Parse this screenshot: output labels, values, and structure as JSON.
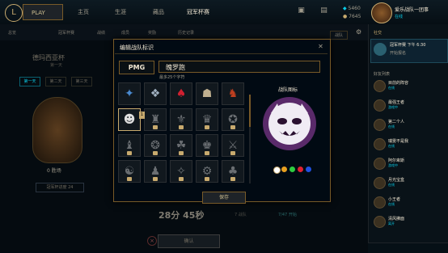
{
  "topbar": {
    "logo": "L",
    "play": "PLAY",
    "tabs": [
      "主页",
      "生涯",
      "藏品",
      "冠军杯赛"
    ],
    "currency_be": "5460",
    "currency_rp": "7645",
    "username": "爱乐战队一团事",
    "status": "在线"
  },
  "subnav": {
    "tabs": [
      "总览",
      "冠军杯赛",
      "战绩",
      "成员",
      "奖励",
      "历史记录"
    ],
    "right_button": "战队"
  },
  "background": {
    "cup_title": "德玛西亚杯",
    "cup_sub": "第一天",
    "days": [
      "第一天",
      "第二天",
      "第三天"
    ],
    "wins": "0 胜场",
    "progress_chip": "冠军杯进度 24",
    "timer": "28分 45秒",
    "confirm": "确认",
    "info_left": "7 战队",
    "info_right": "7/47 开始"
  },
  "social": {
    "header": "社交",
    "notif_title": "冠军杯赛 下午 6:30",
    "notif_body": "开始报名",
    "friends_header": "好友列表",
    "friends": [
      {
        "name": "目前的阵容",
        "status": "在线"
      },
      {
        "name": "最强王者",
        "status": "游戏中"
      },
      {
        "name": "第二个人",
        "status": "在线"
      },
      {
        "name": "瑞雯不是我",
        "status": "在线"
      },
      {
        "name": "阿尔卑斯",
        "status": "游戏中"
      },
      {
        "name": "月光宝盒",
        "status": "在线"
      },
      {
        "name": "小王者",
        "status": "在线"
      },
      {
        "name": "清风拂面",
        "status": "离开"
      }
    ]
  },
  "modal": {
    "title": "编辑战队标识",
    "close_icon": "close-icon",
    "tag": "PMG",
    "team_name": "魄罗跑",
    "name_hint": "最多25个字符",
    "preview_label": "战队图标",
    "save": "保存",
    "badge": "1",
    "colors": [
      "#ffffff",
      "#e8a020",
      "#2ecc40",
      "#e02030",
      "#2050e0"
    ]
  },
  "accent": "#c8aa6e"
}
